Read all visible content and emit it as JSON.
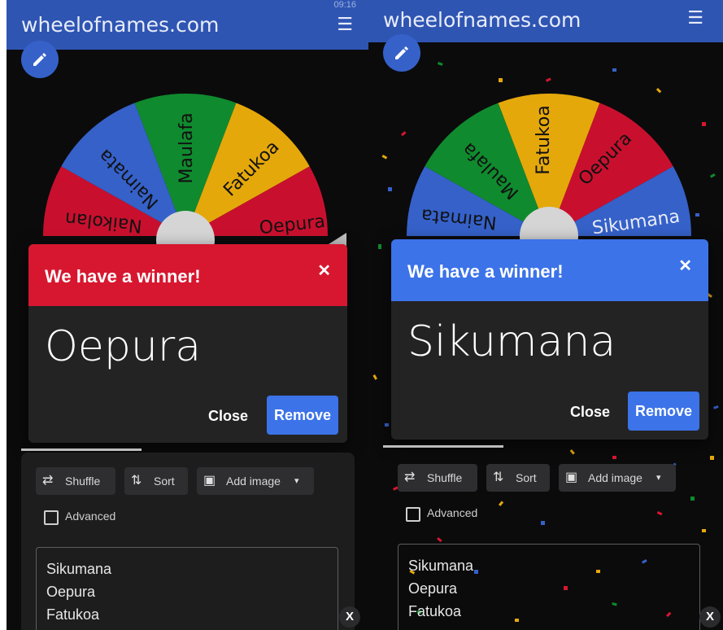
{
  "left": {
    "brand": "wheelofnames.com",
    "clock": "09:16",
    "menu_icon": "☰",
    "wheel_labels": [
      "Naikolan",
      "Naimata",
      "Maulafa",
      "Fatukoa",
      "Oepura"
    ],
    "dialog": {
      "title": "We have a winner!",
      "winner": "Oepura",
      "close_label": "Close",
      "remove_label": "Remove",
      "close_icon": "✕",
      "header_color": "#d7172f"
    },
    "toolbar": {
      "shuffle": "Shuffle",
      "sort": "Sort",
      "add_image": "Add image",
      "advanced": "Advanced"
    },
    "names": [
      "Sikumana",
      "Oepura",
      "Fatukoa"
    ],
    "x_label": "X"
  },
  "right": {
    "brand": "wheelofnames.com",
    "menu_icon": "☰",
    "wheel_labels": [
      "Naimata",
      "Maulafa",
      "Fatukoa",
      "Oepura",
      "Sikumana"
    ],
    "dialog": {
      "title": "We have a winner!",
      "winner": "Sikumana",
      "close_label": "Close",
      "remove_label": "Remove",
      "close_icon": "✕",
      "header_color": "#3c73e8"
    },
    "toolbar": {
      "shuffle": "Shuffle",
      "sort": "Sort",
      "add_image": "Add image",
      "advanced": "Advanced"
    },
    "names": [
      "Sikumana",
      "Oepura",
      "Fatukoa"
    ],
    "x_label": "X"
  },
  "colors": {
    "red": "#c8102e",
    "blue": "#3561c9",
    "green": "#108a2e",
    "yellow": "#e5a80b"
  }
}
